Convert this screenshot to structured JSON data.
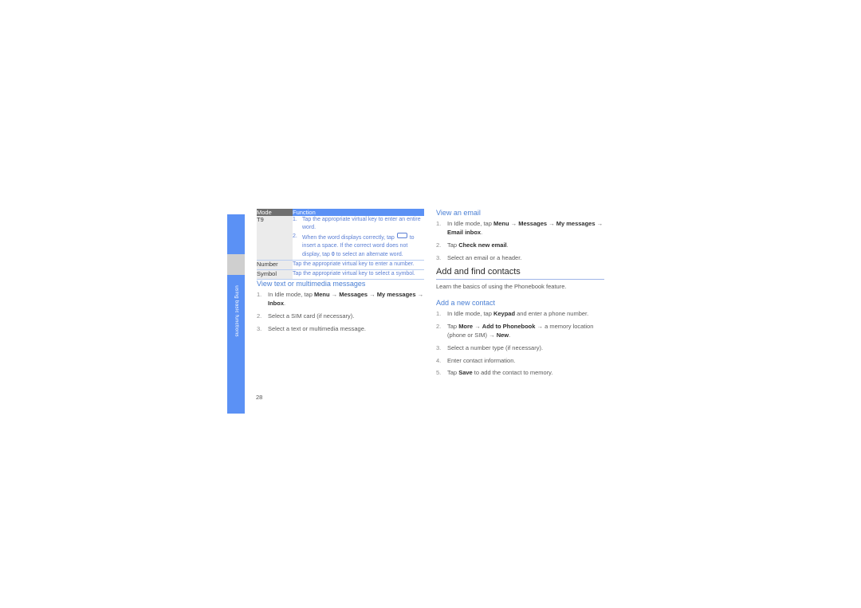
{
  "page": {
    "number": "28",
    "thumb_tab_label": "using basic functions",
    "accent_blue": "#5b91f5",
    "heading_blue": "#4a7fd4",
    "table_header_gray": "#6f6f6f"
  },
  "table": {
    "name": "text-input-modes-table",
    "headers": [
      "Mode",
      "Function"
    ],
    "rows": [
      {
        "mode": "T9",
        "function_steps": [
          {
            "num": "1.",
            "parts": [
              {
                "t": "text",
                "v": "Tap the appropriate virtual key to enter an entire word."
              }
            ]
          },
          {
            "num": "2.",
            "parts": [
              {
                "t": "text",
                "v": "When the word displays correctly, tap "
              },
              {
                "t": "spacekey",
                "v": ""
              },
              {
                "t": "text",
                "v": " to insert a space. If the correct word does not display, tap "
              },
              {
                "t": "bold",
                "v": "0"
              },
              {
                "t": "text",
                "v": " to select an alternate word."
              }
            ]
          }
        ]
      },
      {
        "mode": "Number",
        "function_steps": [
          {
            "num": "",
            "parts": [
              {
                "t": "text",
                "v": "Tap the appropriate virtual key to enter a number."
              }
            ]
          }
        ]
      },
      {
        "mode": "Symbol",
        "function_steps": [
          {
            "num": "",
            "parts": [
              {
                "t": "text",
                "v": "Tap the appropriate virtual key to select a symbol."
              }
            ]
          }
        ]
      }
    ]
  },
  "left_column": {
    "section_view_messages": {
      "heading": "View text or multimedia messages",
      "steps": [
        {
          "num": "1.",
          "parts": [
            {
              "t": "text",
              "v": "In Idle mode, tap "
            },
            {
              "t": "bold",
              "v": "Menu"
            },
            {
              "t": "text",
              "v": " → "
            },
            {
              "t": "bold",
              "v": "Messages"
            },
            {
              "t": "text",
              "v": " → "
            },
            {
              "t": "bold",
              "v": "My messages"
            },
            {
              "t": "text",
              "v": " → "
            },
            {
              "t": "bold",
              "v": "Inbox"
            },
            {
              "t": "text",
              "v": "."
            }
          ]
        },
        {
          "num": "2.",
          "parts": [
            {
              "t": "text",
              "v": "Select a SIM card (if necessary)."
            }
          ]
        },
        {
          "num": "3.",
          "parts": [
            {
              "t": "text",
              "v": "Select a text or multimedia message."
            }
          ]
        }
      ]
    }
  },
  "right_column": {
    "section_view_email": {
      "heading": "View an email",
      "steps": [
        {
          "num": "1.",
          "parts": [
            {
              "t": "text",
              "v": "In Idle mode, tap "
            },
            {
              "t": "bold",
              "v": "Menu"
            },
            {
              "t": "text",
              "v": " → "
            },
            {
              "t": "bold",
              "v": "Messages"
            },
            {
              "t": "text",
              "v": " → "
            },
            {
              "t": "bold",
              "v": "My messages"
            },
            {
              "t": "text",
              "v": " → "
            },
            {
              "t": "bold",
              "v": "Email inbox"
            },
            {
              "t": "text",
              "v": "."
            }
          ]
        },
        {
          "num": "2.",
          "parts": [
            {
              "t": "text",
              "v": "Tap "
            },
            {
              "t": "bold",
              "v": "Check new email"
            },
            {
              "t": "text",
              "v": "."
            }
          ]
        },
        {
          "num": "3.",
          "parts": [
            {
              "t": "text",
              "v": "Select an email or a header."
            }
          ]
        }
      ]
    },
    "section_contacts": {
      "heading": "Add and find contacts",
      "lede": "Learn the basics of using the Phonebook feature.",
      "subheading": "Add a new contact",
      "steps": [
        {
          "num": "1.",
          "parts": [
            {
              "t": "text",
              "v": "In Idle mode, tap "
            },
            {
              "t": "bold",
              "v": "Keypad"
            },
            {
              "t": "text",
              "v": " and enter a phone number."
            }
          ]
        },
        {
          "num": "2.",
          "parts": [
            {
              "t": "text",
              "v": "Tap "
            },
            {
              "t": "bold",
              "v": "More"
            },
            {
              "t": "text",
              "v": " → "
            },
            {
              "t": "bold",
              "v": "Add to Phonebook"
            },
            {
              "t": "text",
              "v": " → a memory location (phone or SIM) → "
            },
            {
              "t": "bold",
              "v": "New"
            },
            {
              "t": "text",
              "v": "."
            }
          ]
        },
        {
          "num": "3.",
          "parts": [
            {
              "t": "text",
              "v": "Select a number type (if necessary)."
            }
          ]
        },
        {
          "num": "4.",
          "parts": [
            {
              "t": "text",
              "v": "Enter contact information."
            }
          ]
        },
        {
          "num": "5.",
          "parts": [
            {
              "t": "text",
              "v": "Tap "
            },
            {
              "t": "bold",
              "v": "Save"
            },
            {
              "t": "text",
              "v": " to add the contact to memory."
            }
          ]
        }
      ]
    }
  }
}
